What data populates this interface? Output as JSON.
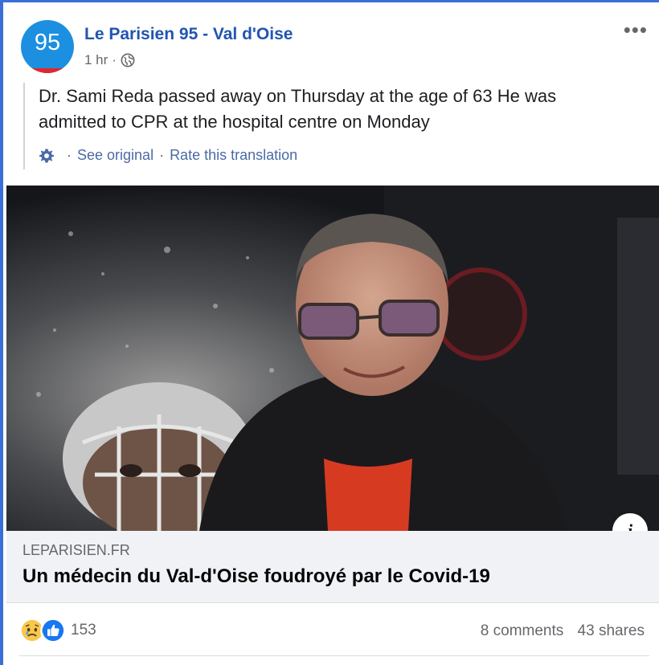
{
  "post": {
    "page_name": "Le Parisien 95 - Val d'Oise",
    "avatar_text": "95",
    "time": "1 hr",
    "separator": "·",
    "text": "Dr. Sami Reda passed away on Thursday at the age of 63 He was admitted to CPR at the hospital centre on Monday",
    "more_icon": "more-dots-icon",
    "privacy_icon": "globe-icon"
  },
  "translation": {
    "see_original": "See original",
    "separator": "·",
    "rate": "Rate this translation",
    "icon": "gear-icon"
  },
  "link": {
    "image_description_icon": "info-icon",
    "domain": "LEPARISIEN.FR",
    "title": "Un médecin du Val-d'Oise foudroyé par le Covid-19"
  },
  "engagement": {
    "reaction_icons": [
      "sad-reaction-icon",
      "like-reaction-icon"
    ],
    "reaction_count": "153",
    "comments": "8 comments",
    "shares": "43 shares"
  },
  "colors": {
    "accent": "#2155b0",
    "avatar": "#1d8fe0",
    "frame": "#3b6fd8",
    "link_bg": "#f0f2f5"
  }
}
